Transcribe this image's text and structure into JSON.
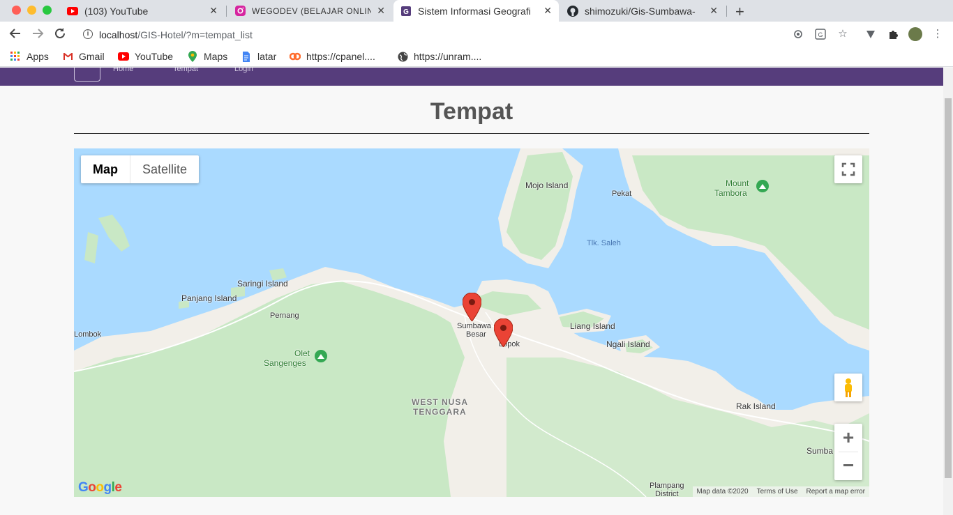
{
  "browser": {
    "tabs": [
      {
        "title": "(103) YouTube",
        "favicon": "youtube-icon",
        "active": false
      },
      {
        "title": "WEGODEV (BELAJAR ONLINE",
        "favicon": "instagram-icon",
        "active": false
      },
      {
        "title": "Sistem Informasi Geografi",
        "favicon": "gis-app-icon",
        "active": true
      },
      {
        "title": "shimozuki/Gis-Sumbawa-",
        "favicon": "github-icon",
        "active": false
      }
    ],
    "new_tab_label": "+",
    "close_label": "✕",
    "url": {
      "host": "localhost",
      "path": "/GIS-Hotel/?m=tempat_list"
    }
  },
  "bookmarks": [
    {
      "label": "Apps",
      "icon": "apps-grid-icon"
    },
    {
      "label": "Gmail",
      "icon": "gmail-icon"
    },
    {
      "label": "YouTube",
      "icon": "youtube-icon"
    },
    {
      "label": "Maps",
      "icon": "maps-icon"
    },
    {
      "label": "latar",
      "icon": "document-icon"
    },
    {
      "label": "https://cpanel....",
      "icon": "cpanel-icon"
    },
    {
      "label": "https://unram....",
      "icon": "globe-icon"
    }
  ],
  "page": {
    "title": "Tempat",
    "nav": {
      "home": "Home",
      "tempat": "Tempat",
      "login": "Login"
    }
  },
  "map": {
    "type_buttons": {
      "map": "Map",
      "satellite": "Satellite"
    },
    "selected_type": "Map",
    "zoom_in": "+",
    "zoom_out": "−",
    "labels": {
      "mojo": "Mojo Island",
      "pekat": "Pekat",
      "tambora_1": "Mount",
      "tambora_2": "Tambora",
      "saleh": "Tlk. Saleh",
      "saringi": "Saringi Island",
      "panjang": "Panjang Island",
      "pernang": "Pernang",
      "lombok": "Lombok",
      "sumbawa_besar_1": "Sumbawa",
      "sumbawa_besar_2": "Besar",
      "lopok": "Lopok",
      "liang": "Liang Island",
      "ngali": "Ngali Island",
      "olet_1": "Olet",
      "olet_2": "Sangenges",
      "ntb_1": "WEST NUSA",
      "ntb_2": "TENGGARA",
      "rak": "Rak Island",
      "sumba": "Sumba",
      "plampang_1": "Plampang",
      "plampang_2": "District"
    },
    "attribution": {
      "data": "Map data ©2020",
      "terms": "Terms of Use",
      "report": "Report a map error"
    },
    "logo": "Google",
    "markers": 2,
    "colors": {
      "water": "#aadaff",
      "land": "#f2efe9",
      "forest": "#c9e8c5",
      "marker": "#ea4335",
      "navbar": "#563d7c"
    }
  }
}
